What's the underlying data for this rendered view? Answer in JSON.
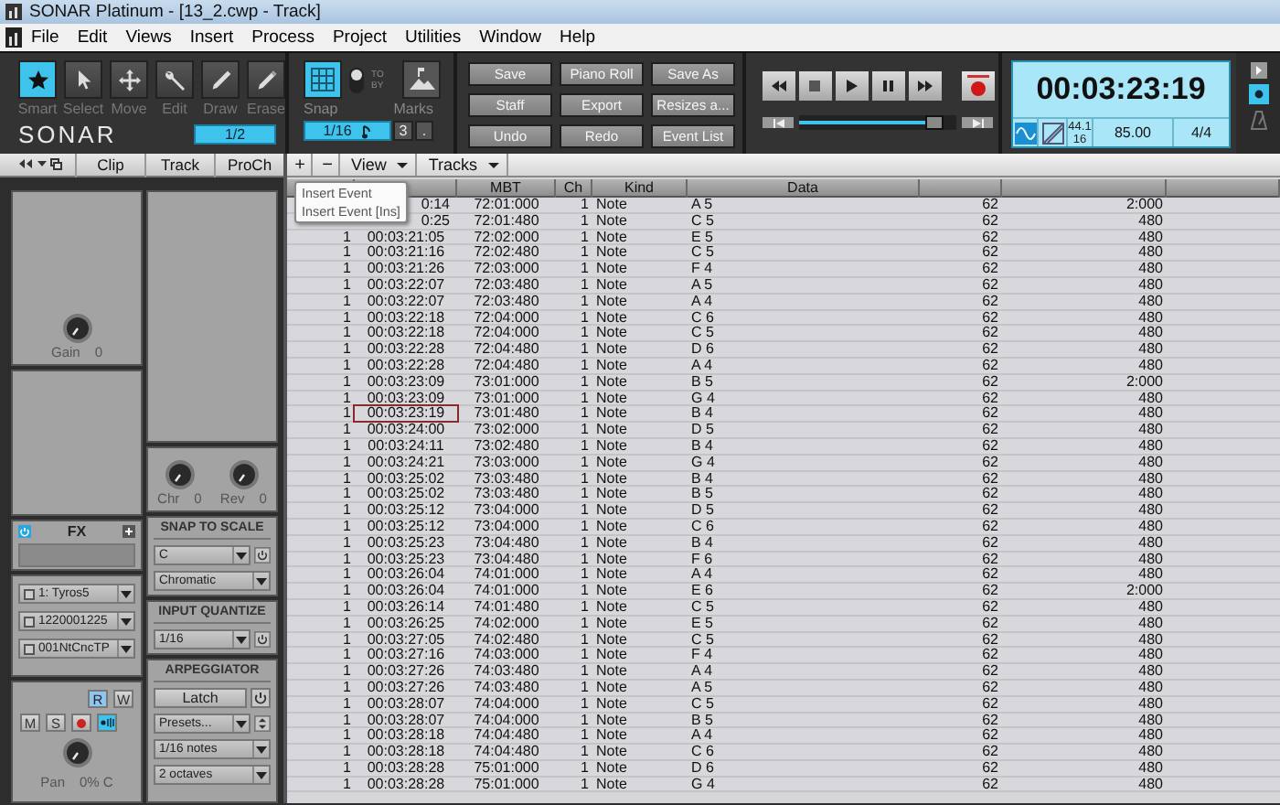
{
  "window": {
    "title": "SONAR Platinum - [13_2.cwp - Track]"
  },
  "menu": [
    "File",
    "Edit",
    "Views",
    "Insert",
    "Process",
    "Project",
    "Utilities",
    "Window",
    "Help"
  ],
  "tools": [
    {
      "label": "Smart",
      "kind": "smart",
      "selected": true
    },
    {
      "label": "Select",
      "kind": "select",
      "selected": false
    },
    {
      "label": "Move",
      "kind": "move",
      "selected": false
    },
    {
      "label": "Edit",
      "kind": "edit",
      "selected": false
    },
    {
      "label": "Draw",
      "kind": "draw",
      "selected": false
    },
    {
      "label": "Erase",
      "kind": "erase",
      "selected": false
    }
  ],
  "logo": "SONAR",
  "tool_resolution": "1/2",
  "snap": {
    "label": "Snap",
    "on": true,
    "to_on": true,
    "to_label": "TO",
    "by_label": "BY",
    "marks_label": "Marks",
    "resolution": "1/16",
    "triplet": "3",
    "dotted": "."
  },
  "commands": [
    "Save",
    "Piano Roll",
    "Save As",
    "Staff",
    "Export",
    "Resizes a...",
    "Undo",
    "Redo",
    "Event List"
  ],
  "transport": {
    "buttons": [
      {
        "kind": "rewind"
      },
      {
        "kind": "stop"
      },
      {
        "kind": "play"
      },
      {
        "kind": "pause"
      },
      {
        "kind": "forward"
      }
    ],
    "record_armed": true,
    "scrub": {
      "level": 0.86
    }
  },
  "now_time": {
    "time": "00:03:23:19",
    "sample_rate": "44.1",
    "bit_depth": "16",
    "tempo": "85.00",
    "meter": "4/4",
    "wave_on": true
  },
  "inspector": {
    "tabs": [
      "Clip",
      "Track",
      "ProCh"
    ],
    "gain": {
      "label": "Gain",
      "value": "0"
    },
    "fx": {
      "label": "FX",
      "on": true
    },
    "ports": [
      "1: Tyros5",
      "1220001225",
      "001NtCncTP"
    ],
    "strip": {
      "read": "R",
      "write": "W",
      "read_on": true,
      "mute": "M",
      "solo": "S",
      "input_echo_on": true
    },
    "pan": {
      "label": "Pan",
      "value": "0% C"
    },
    "sends": [
      {
        "label": "Chr",
        "value": "0"
      },
      {
        "label": "Rev",
        "value": "0"
      }
    ],
    "snap_to_scale": {
      "title": "SNAP TO SCALE",
      "key": "C",
      "scale": "Chromatic"
    },
    "input_quantize": {
      "title": "INPUT QUANTIZE",
      "value": "1/16"
    },
    "arpeggiator": {
      "title": "ARPEGGIATOR",
      "latch": "Latch",
      "preset": "Presets...",
      "rate": "1/16 notes",
      "range": "2 octaves"
    }
  },
  "event_list": {
    "toolbar": {
      "add": "+",
      "remove": "−",
      "menus": [
        "View",
        "Tracks"
      ]
    },
    "tooltip": [
      "Insert Event",
      "Insert Event [Ins]"
    ],
    "columns": [
      "MBT",
      "Ch",
      "Kind",
      "Data"
    ],
    "rows": [
      {
        "hmsf": "0:14",
        "mbt": "72:01:000",
        "ch": "1",
        "kind": "Note",
        "data": "A 5",
        "column_7": "62",
        "column_8": "2:000",
        "selected": false
      },
      {
        "hmsf": "0:25",
        "mbt": "72:01:480",
        "ch": "1",
        "kind": "Note",
        "data": "C 5",
        "column_7": "62",
        "column_8": "480",
        "selected": false
      },
      {
        "trk": "1",
        "hmsf": "00:03:21:05",
        "mbt": "72:02:000",
        "ch": "1",
        "kind": "Note",
        "data": "E 5",
        "column_7": "62",
        "column_8": "480",
        "selected": false
      },
      {
        "trk": "1",
        "hmsf": "00:03:21:16",
        "mbt": "72:02:480",
        "ch": "1",
        "kind": "Note",
        "data": "C 5",
        "column_7": "62",
        "column_8": "480",
        "selected": false
      },
      {
        "trk": "1",
        "hmsf": "00:03:21:26",
        "mbt": "72:03:000",
        "ch": "1",
        "kind": "Note",
        "data": "F 4",
        "column_7": "62",
        "column_8": "480",
        "selected": false
      },
      {
        "trk": "1",
        "hmsf": "00:03:22:07",
        "mbt": "72:03:480",
        "ch": "1",
        "kind": "Note",
        "data": "A 5",
        "column_7": "62",
        "column_8": "480",
        "selected": false
      },
      {
        "trk": "1",
        "hmsf": "00:03:22:07",
        "mbt": "72:03:480",
        "ch": "1",
        "kind": "Note",
        "data": "A 4",
        "column_7": "62",
        "column_8": "480",
        "selected": false
      },
      {
        "trk": "1",
        "hmsf": "00:03:22:18",
        "mbt": "72:04:000",
        "ch": "1",
        "kind": "Note",
        "data": "C 6",
        "column_7": "62",
        "column_8": "480",
        "selected": false
      },
      {
        "trk": "1",
        "hmsf": "00:03:22:18",
        "mbt": "72:04:000",
        "ch": "1",
        "kind": "Note",
        "data": "C 5",
        "column_7": "62",
        "column_8": "480",
        "selected": false
      },
      {
        "trk": "1",
        "hmsf": "00:03:22:28",
        "mbt": "72:04:480",
        "ch": "1",
        "kind": "Note",
        "data": "D 6",
        "column_7": "62",
        "column_8": "480",
        "selected": false
      },
      {
        "trk": "1",
        "hmsf": "00:03:22:28",
        "mbt": "72:04:480",
        "ch": "1",
        "kind": "Note",
        "data": "A 4",
        "column_7": "62",
        "column_8": "480",
        "selected": false
      },
      {
        "trk": "1",
        "hmsf": "00:03:23:09",
        "mbt": "73:01:000",
        "ch": "1",
        "kind": "Note",
        "data": "B 5",
        "column_7": "62",
        "column_8": "2:000",
        "selected": false
      },
      {
        "trk": "1",
        "hmsf": "00:03:23:09",
        "mbt": "73:01:000",
        "ch": "1",
        "kind": "Note",
        "data": "G 4",
        "column_7": "62",
        "column_8": "480",
        "selected": false
      },
      {
        "trk": "1",
        "hmsf": "00:03:23:19",
        "mbt": "73:01:480",
        "ch": "1",
        "kind": "Note",
        "data": "B 4",
        "column_7": "62",
        "column_8": "480",
        "selected": true
      },
      {
        "trk": "1",
        "hmsf": "00:03:24:00",
        "mbt": "73:02:000",
        "ch": "1",
        "kind": "Note",
        "data": "D 5",
        "column_7": "62",
        "column_8": "480",
        "selected": false
      },
      {
        "trk": "1",
        "hmsf": "00:03:24:11",
        "mbt": "73:02:480",
        "ch": "1",
        "kind": "Note",
        "data": "B 4",
        "column_7": "62",
        "column_8": "480",
        "selected": false
      },
      {
        "trk": "1",
        "hmsf": "00:03:24:21",
        "mbt": "73:03:000",
        "ch": "1",
        "kind": "Note",
        "data": "G 4",
        "column_7": "62",
        "column_8": "480",
        "selected": false
      },
      {
        "trk": "1",
        "hmsf": "00:03:25:02",
        "mbt": "73:03:480",
        "ch": "1",
        "kind": "Note",
        "data": "B 4",
        "column_7": "62",
        "column_8": "480",
        "selected": false
      },
      {
        "trk": "1",
        "hmsf": "00:03:25:02",
        "mbt": "73:03:480",
        "ch": "1",
        "kind": "Note",
        "data": "B 5",
        "column_7": "62",
        "column_8": "480",
        "selected": false
      },
      {
        "trk": "1",
        "hmsf": "00:03:25:12",
        "mbt": "73:04:000",
        "ch": "1",
        "kind": "Note",
        "data": "D 5",
        "column_7": "62",
        "column_8": "480",
        "selected": false
      },
      {
        "trk": "1",
        "hmsf": "00:03:25:12",
        "mbt": "73:04:000",
        "ch": "1",
        "kind": "Note",
        "data": "C 6",
        "column_7": "62",
        "column_8": "480",
        "selected": false
      },
      {
        "trk": "1",
        "hmsf": "00:03:25:23",
        "mbt": "73:04:480",
        "ch": "1",
        "kind": "Note",
        "data": "B 4",
        "column_7": "62",
        "column_8": "480",
        "selected": false
      },
      {
        "trk": "1",
        "hmsf": "00:03:25:23",
        "mbt": "73:04:480",
        "ch": "1",
        "kind": "Note",
        "data": "F 6",
        "column_7": "62",
        "column_8": "480",
        "selected": false
      },
      {
        "trk": "1",
        "hmsf": "00:03:26:04",
        "mbt": "74:01:000",
        "ch": "1",
        "kind": "Note",
        "data": "A 4",
        "column_7": "62",
        "column_8": "480",
        "selected": false
      },
      {
        "trk": "1",
        "hmsf": "00:03:26:04",
        "mbt": "74:01:000",
        "ch": "1",
        "kind": "Note",
        "data": "E 6",
        "column_7": "62",
        "column_8": "2:000",
        "selected": false
      },
      {
        "trk": "1",
        "hmsf": "00:03:26:14",
        "mbt": "74:01:480",
        "ch": "1",
        "kind": "Note",
        "data": "C 5",
        "column_7": "62",
        "column_8": "480",
        "selected": false
      },
      {
        "trk": "1",
        "hmsf": "00:03:26:25",
        "mbt": "74:02:000",
        "ch": "1",
        "kind": "Note",
        "data": "E 5",
        "column_7": "62",
        "column_8": "480",
        "selected": false
      },
      {
        "trk": "1",
        "hmsf": "00:03:27:05",
        "mbt": "74:02:480",
        "ch": "1",
        "kind": "Note",
        "data": "C 5",
        "column_7": "62",
        "column_8": "480",
        "selected": false
      },
      {
        "trk": "1",
        "hmsf": "00:03:27:16",
        "mbt": "74:03:000",
        "ch": "1",
        "kind": "Note",
        "data": "F 4",
        "column_7": "62",
        "column_8": "480",
        "selected": false
      },
      {
        "trk": "1",
        "hmsf": "00:03:27:26",
        "mbt": "74:03:480",
        "ch": "1",
        "kind": "Note",
        "data": "A 4",
        "column_7": "62",
        "column_8": "480",
        "selected": false
      },
      {
        "trk": "1",
        "hmsf": "00:03:27:26",
        "mbt": "74:03:480",
        "ch": "1",
        "kind": "Note",
        "data": "A 5",
        "column_7": "62",
        "column_8": "480",
        "selected": false
      },
      {
        "trk": "1",
        "hmsf": "00:03:28:07",
        "mbt": "74:04:000",
        "ch": "1",
        "kind": "Note",
        "data": "C 5",
        "column_7": "62",
        "column_8": "480",
        "selected": false
      },
      {
        "trk": "1",
        "hmsf": "00:03:28:07",
        "mbt": "74:04:000",
        "ch": "1",
        "kind": "Note",
        "data": "B 5",
        "column_7": "62",
        "column_8": "480",
        "selected": false
      },
      {
        "trk": "1",
        "hmsf": "00:03:28:18",
        "mbt": "74:04:480",
        "ch": "1",
        "kind": "Note",
        "data": "A 4",
        "column_7": "62",
        "column_8": "480",
        "selected": false
      },
      {
        "trk": "1",
        "hmsf": "00:03:28:18",
        "mbt": "74:04:480",
        "ch": "1",
        "kind": "Note",
        "data": "C 6",
        "column_7": "62",
        "column_8": "480",
        "selected": false
      },
      {
        "trk": "1",
        "hmsf": "00:03:28:28",
        "mbt": "75:01:000",
        "ch": "1",
        "kind": "Note",
        "data": "D 6",
        "column_7": "62",
        "column_8": "480",
        "selected": false
      },
      {
        "trk": "1",
        "hmsf": "00:03:28:28",
        "mbt": "75:01:000",
        "ch": "1",
        "kind": "Note",
        "data": "G 4",
        "column_7": "62",
        "column_8": "480",
        "selected": false
      }
    ]
  }
}
